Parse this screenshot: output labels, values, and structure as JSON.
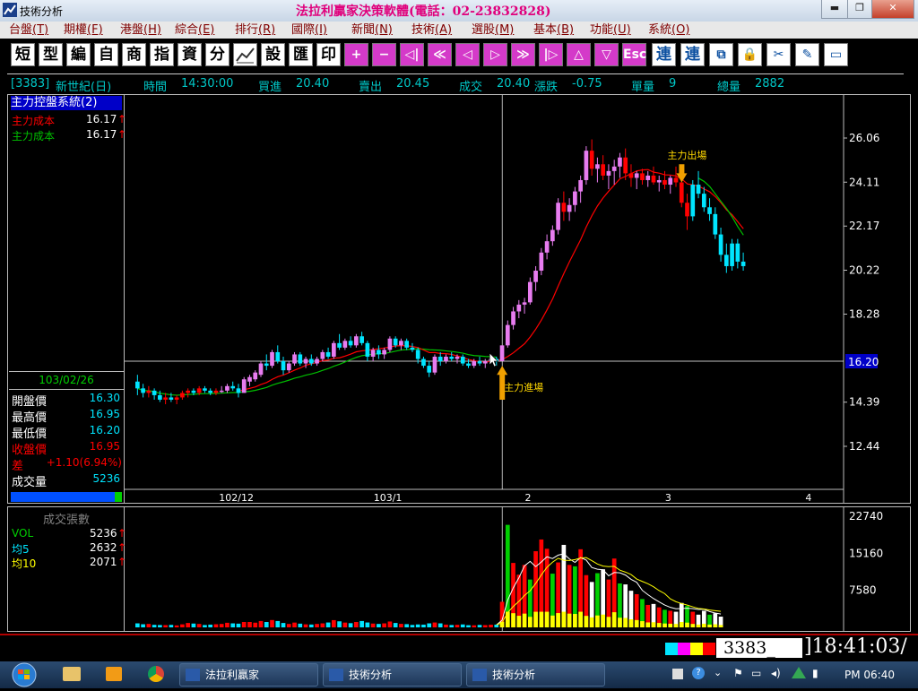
{
  "window": {
    "app_title": "技術分析",
    "main_title": "法拉利贏家決策軟體(電話：02-23832828)",
    "min_btn": "▬",
    "max_btn": "❐",
    "close_btn": "✕"
  },
  "menu": [
    {
      "label": "台盤",
      "key": "(T)"
    },
    {
      "label": "期權",
      "key": "(F)"
    },
    {
      "label": "港盤",
      "key": "(H)"
    },
    {
      "label": "綜合",
      "key": "(E)"
    },
    {
      "label": "排行",
      "key": "(R)"
    },
    {
      "label": "國際",
      "key": "(I)"
    },
    {
      "label": "新聞",
      "key": "(N)"
    },
    {
      "label": "技術",
      "key": "(A)"
    },
    {
      "label": "選股",
      "key": "(M)"
    },
    {
      "label": "基本",
      "key": "(B)"
    },
    {
      "label": "功能",
      "key": "(U)"
    },
    {
      "label": "系統",
      "key": "(O)"
    }
  ],
  "toolbar": {
    "text_buttons": [
      "短",
      "型",
      "編",
      "自",
      "商",
      "指",
      "資",
      "分"
    ],
    "chart_icon": "chart-icon",
    "text_buttons2": [
      "設",
      "匯",
      "印"
    ],
    "pink_buttons": [
      "+",
      "−",
      "◁|",
      "≪",
      "◁",
      "▷",
      "≫",
      "|▷",
      "△",
      "▽",
      "Esc"
    ],
    "right_buttons": [
      "連",
      "連",
      "⧉",
      "🔒",
      "✂",
      "✎",
      "▭"
    ]
  },
  "quote": {
    "code": "[3383]",
    "name": "新世紀(日)",
    "time_label": "時間",
    "time": "14:30:00",
    "bid_label": "買進",
    "bid": "20.40",
    "ask_label": "賣出",
    "ask": "20.45",
    "deal_label": "成交",
    "deal": "20.40",
    "change_label": "漲跌",
    "change": "-0.75",
    "unit_label": "單量",
    "unit": "9",
    "total_label": "總量",
    "total": "2882"
  },
  "left_panel": {
    "system_title": "主力控盤系統(2)",
    "cost1_label": "主力成本",
    "cost1": "16.17",
    "cost2_label": "主力成本",
    "cost2": "16.17",
    "date": "103/02/26",
    "open_label": "開盤價",
    "open": "16.30",
    "high_label": "最高價",
    "high": "16.95",
    "low_label": "最低價",
    "low": "16.20",
    "close_label": "收盤價",
    "close": "16.95",
    "diff_label": "差",
    "diff": "+1.10(6.94%)",
    "vol_label": "成交量",
    "vol": "5236"
  },
  "volume_panel": {
    "title": "成交張數",
    "vol_label": "VOL",
    "vol": "5236",
    "ma5_label": "均5",
    "ma5": "2632",
    "ma10_label": "均10",
    "ma10": "2071"
  },
  "chart_data": {
    "type": "candlestick",
    "y_ticks": [
      "26.06",
      "24.11",
      "22.17",
      "20.22",
      "18.28",
      "14.39",
      "12.44"
    ],
    "cursor_price": "16.20",
    "x_ticks": [
      "102/12",
      "103/1",
      "2",
      "3",
      "4"
    ],
    "annotations": [
      "主力出場",
      "主力進場"
    ],
    "volume_ticks": [
      "22740",
      "15160",
      "7580"
    ],
    "candles": [
      [
        15.3,
        15.6,
        14.7,
        15.0
      ],
      [
        15.0,
        15.2,
        14.6,
        14.8
      ],
      [
        14.8,
        15.1,
        14.6,
        14.9
      ],
      [
        14.9,
        15.0,
        14.5,
        14.7
      ],
      [
        14.7,
        14.9,
        14.4,
        14.5
      ],
      [
        14.5,
        14.8,
        14.3,
        14.6
      ],
      [
        14.6,
        14.8,
        14.4,
        14.5
      ],
      [
        14.5,
        14.7,
        14.3,
        14.6
      ],
      [
        14.6,
        14.9,
        14.5,
        14.8
      ],
      [
        14.8,
        15.0,
        14.6,
        14.9
      ],
      [
        14.9,
        15.0,
        14.7,
        14.8
      ],
      [
        14.8,
        15.1,
        14.7,
        15.0
      ],
      [
        15.0,
        15.1,
        14.8,
        14.9
      ],
      [
        14.9,
        15.0,
        14.7,
        14.8
      ],
      [
        14.8,
        15.0,
        14.7,
        14.9
      ],
      [
        14.9,
        15.1,
        14.8,
        14.9
      ],
      [
        14.9,
        15.2,
        14.8,
        15.1
      ],
      [
        15.1,
        15.3,
        14.9,
        15.0
      ],
      [
        15.0,
        15.2,
        14.6,
        14.8
      ],
      [
        14.8,
        15.5,
        14.8,
        15.4
      ],
      [
        15.3,
        15.6,
        15.1,
        15.5
      ],
      [
        15.4,
        15.8,
        15.3,
        15.7
      ],
      [
        15.6,
        16.2,
        15.5,
        16.1
      ],
      [
        16.1,
        16.5,
        15.8,
        16.0
      ],
      [
        16.0,
        16.7,
        15.9,
        16.6
      ],
      [
        16.6,
        16.9,
        16.1,
        16.2
      ],
      [
        16.2,
        16.4,
        15.6,
        15.8
      ],
      [
        15.8,
        16.2,
        15.7,
        16.1
      ],
      [
        16.1,
        16.6,
        16.0,
        16.5
      ],
      [
        16.5,
        16.6,
        16.0,
        16.1
      ],
      [
        16.1,
        16.4,
        15.9,
        16.3
      ],
      [
        16.3,
        16.5,
        16.0,
        16.1
      ],
      [
        16.1,
        16.4,
        16.0,
        16.3
      ],
      [
        16.3,
        16.7,
        16.2,
        16.6
      ],
      [
        16.6,
        16.8,
        16.3,
        16.4
      ],
      [
        16.4,
        17.1,
        16.3,
        17.0
      ],
      [
        17.0,
        17.4,
        16.7,
        16.8
      ],
      [
        16.8,
        17.2,
        16.7,
        17.1
      ],
      [
        17.1,
        17.3,
        16.8,
        16.9
      ],
      [
        16.9,
        17.4,
        16.8,
        17.3
      ],
      [
        17.3,
        17.5,
        16.9,
        17.0
      ],
      [
        17.0,
        17.1,
        16.2,
        16.4
      ],
      [
        16.4,
        16.8,
        16.2,
        16.7
      ],
      [
        16.7,
        16.9,
        16.3,
        16.5
      ],
      [
        16.5,
        16.8,
        16.3,
        16.7
      ],
      [
        16.7,
        17.3,
        16.6,
        17.2
      ],
      [
        17.2,
        17.3,
        16.8,
        16.9
      ],
      [
        16.9,
        17.2,
        16.7,
        17.1
      ],
      [
        17.1,
        17.2,
        16.7,
        16.8
      ],
      [
        16.8,
        17.0,
        16.6,
        16.7
      ],
      [
        16.7,
        16.8,
        16.1,
        16.3
      ],
      [
        16.3,
        16.4,
        15.9,
        16.0
      ],
      [
        16.0,
        16.2,
        15.5,
        15.7
      ],
      [
        15.7,
        16.5,
        15.6,
        16.4
      ],
      [
        16.4,
        16.6,
        16.0,
        16.2
      ],
      [
        16.2,
        16.5,
        16.1,
        16.4
      ],
      [
        16.4,
        16.6,
        16.2,
        16.3
      ],
      [
        16.3,
        16.5,
        16.1,
        16.4
      ],
      [
        16.4,
        16.5,
        16.0,
        16.1
      ],
      [
        16.1,
        16.3,
        15.9,
        16.0
      ],
      [
        16.0,
        16.3,
        15.9,
        16.2
      ],
      [
        16.2,
        16.4,
        16.0,
        16.1
      ],
      [
        16.1,
        16.3,
        15.9,
        16.2
      ],
      [
        16.2,
        16.5,
        16.1,
        16.3
      ],
      [
        16.3,
        16.4,
        16.0,
        16.2
      ],
      [
        16.2,
        16.9,
        16.2,
        16.9
      ],
      [
        16.9,
        18.0,
        16.8,
        17.8
      ],
      [
        17.8,
        18.6,
        17.6,
        18.4
      ],
      [
        18.4,
        18.9,
        18.1,
        18.7
      ],
      [
        18.7,
        19.0,
        18.3,
        18.8
      ],
      [
        18.8,
        19.9,
        18.7,
        19.7
      ],
      [
        19.7,
        20.4,
        19.3,
        20.2
      ],
      [
        20.2,
        21.2,
        20.0,
        21.0
      ],
      [
        21.0,
        21.8,
        20.7,
        21.5
      ],
      [
        21.5,
        22.2,
        21.3,
        22.0
      ],
      [
        22.0,
        23.4,
        21.8,
        23.2
      ],
      [
        23.2,
        23.7,
        22.4,
        22.8
      ],
      [
        22.8,
        23.4,
        22.4,
        23.1
      ],
      [
        23.1,
        23.9,
        22.8,
        23.7
      ],
      [
        23.7,
        24.4,
        23.2,
        24.2
      ],
      [
        24.2,
        25.7,
        24.0,
        25.5
      ],
      [
        25.5,
        26.0,
        24.4,
        24.7
      ],
      [
        24.7,
        25.2,
        24.1,
        24.9
      ],
      [
        24.9,
        25.3,
        24.2,
        24.4
      ],
      [
        24.4,
        24.9,
        23.8,
        24.6
      ],
      [
        24.6,
        25.1,
        24.0,
        24.8
      ],
      [
        24.8,
        25.4,
        24.3,
        25.2
      ],
      [
        25.2,
        25.6,
        24.2,
        24.5
      ],
      [
        24.5,
        24.9,
        23.9,
        24.3
      ],
      [
        24.3,
        24.6,
        23.8,
        24.5
      ],
      [
        24.5,
        24.7,
        24.0,
        24.2
      ],
      [
        24.2,
        24.6,
        23.9,
        24.4
      ],
      [
        24.4,
        24.8,
        24.0,
        24.1
      ],
      [
        24.1,
        24.4,
        23.7,
        24.2
      ],
      [
        24.2,
        24.6,
        23.8,
        24.0
      ],
      [
        24.0,
        24.4,
        23.6,
        24.3
      ],
      [
        24.3,
        24.8,
        23.9,
        24.1
      ],
      [
        24.1,
        24.3,
        23.0,
        23.2
      ],
      [
        23.2,
        23.6,
        22.0,
        22.6
      ],
      [
        22.6,
        24.2,
        22.4,
        24.0
      ],
      [
        24.0,
        24.6,
        23.4,
        23.6
      ],
      [
        23.6,
        23.9,
        22.8,
        23.0
      ],
      [
        23.0,
        23.4,
        22.4,
        22.7
      ],
      [
        22.7,
        23.0,
        21.6,
        21.8
      ],
      [
        21.8,
        22.1,
        20.6,
        20.9
      ],
      [
        20.9,
        21.4,
        20.1,
        20.4
      ],
      [
        20.4,
        21.6,
        20.2,
        21.4
      ],
      [
        21.4,
        21.6,
        20.3,
        20.6
      ],
      [
        20.6,
        21.0,
        20.2,
        20.4
      ]
    ],
    "volumes": [
      820,
      640,
      700,
      520,
      480,
      460,
      510,
      400,
      620,
      900,
      780,
      700,
      480,
      560,
      640,
      700,
      940,
      820,
      760,
      1100,
      1100,
      960,
      1300,
      1100,
      1500,
      1300,
      900,
      700,
      980,
      760,
      620,
      580,
      700,
      820,
      1000,
      1480,
      1240,
      980,
      860,
      1100,
      1300,
      1000,
      780,
      700,
      820,
      1200,
      900,
      720,
      660,
      500,
      600,
      560,
      820,
      1000,
      820,
      560,
      480,
      520,
      600,
      440,
      420,
      500,
      460,
      540,
      560,
      5236,
      21000,
      13200,
      10800,
      12800,
      9800,
      15600,
      18000,
      16100,
      11000,
      13300,
      16900,
      12800,
      12500,
      16000,
      10700,
      9300,
      11100,
      11900,
      9800,
      14100,
      9000,
      8800,
      7500,
      6800,
      5800,
      4600,
      4800,
      4100,
      3600,
      3400,
      3200,
      5000,
      4400,
      3200,
      2600,
      3400,
      2600,
      2900,
      2200
    ]
  },
  "status": {
    "code_box": "3383_",
    "clock": "18:41:03"
  },
  "taskbar": {
    "items": [
      "法拉利贏家",
      "技術分析",
      "技術分析"
    ],
    "time": "PM 06:40"
  },
  "colors": {
    "up": "#ff0000",
    "down": "#00e5ff",
    "up_after_signal": "#e87cf0",
    "ma_short": "#ff0000",
    "ma_long": "#00c000",
    "volume_ma5": "#ffffff",
    "volume_ma10": "#ffff00"
  }
}
